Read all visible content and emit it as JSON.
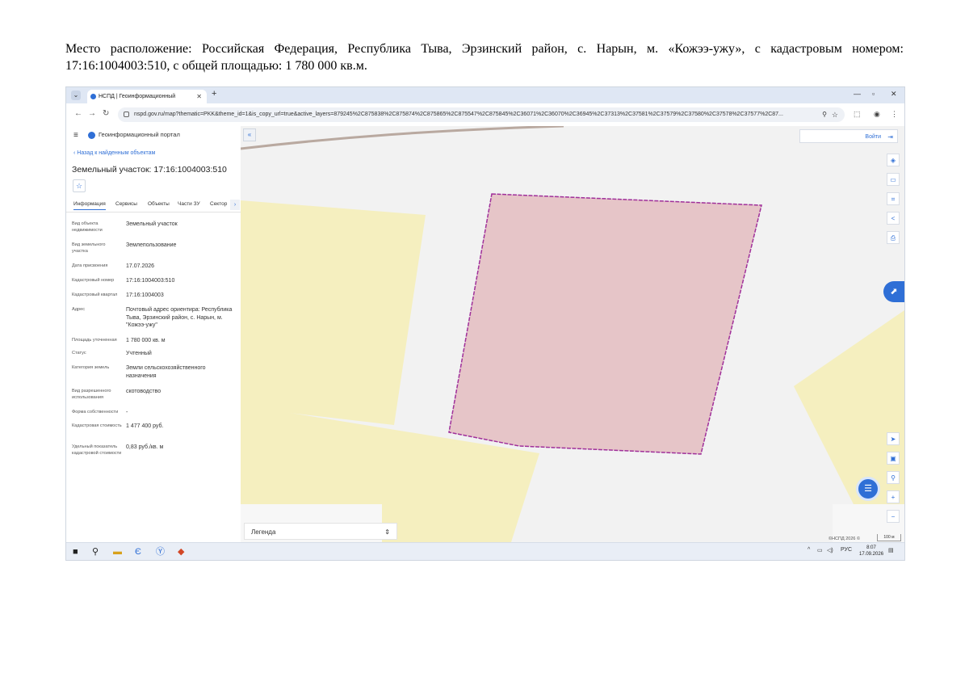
{
  "caption": "Место расположение: Российская Федерация, Республика Тыва, Эрзинский район, с. Нарын, м. «Кожээ-ужу», с кадастровым номером: 17:16:1004003:510, с общей площадью: 1 780 000 кв.м.",
  "browser": {
    "tab_title": "НСПД | Геоинформационный",
    "url": "nspd.gov.ru/map?thematic=PKK&theme_id=1&is_copy_url=true&active_layers=879245%2C875838%2C875874%2C875865%2C875547%2C875845%2C36071%2C36070%2C36945%2C37313%2C37581%2C37579%2C37580%2C37578%2C37577%2C87..."
  },
  "panel": {
    "portal_title": "Геоинформационный портал",
    "back_link": "Назад к найденным объектам",
    "object_title": "Земельный участок: 17:16:1004003:510",
    "tabs": [
      "Информация",
      "Сервисы",
      "Объекты",
      "Части ЗУ",
      "Сектор"
    ],
    "fields": [
      {
        "k": "Вид объекта недвижимости",
        "v": "Земельный участок"
      },
      {
        "k": "Вид земельного участка",
        "v": "Землепользование"
      },
      {
        "k": "Дата присвоения",
        "v": "17.07.2026"
      },
      {
        "k": "Кадастровый номер",
        "v": "17:16:1004003:510"
      },
      {
        "k": "Кадастровый квартал",
        "v": "17:16:1004003"
      },
      {
        "k": "Адрес",
        "v": "Почтовый адрес ориентира: Республика Тыва, Эрзинский район, с. Нарын, м. \"Кожээ-ужу\""
      },
      {
        "k": "Площадь уточненная",
        "v": "1 780 000 кв. м"
      },
      {
        "k": "Статус",
        "v": "Учтенный"
      },
      {
        "k": "Категория земель",
        "v": "Земли сельскохозяйственного назначения"
      },
      {
        "k": "Вид разрешенного использования",
        "v": "скотоводство"
      },
      {
        "k": "Форма собственности",
        "v": "-"
      },
      {
        "k": "Кадастровая стоимость",
        "v": "1 477 400 руб."
      },
      {
        "k": "Удельный показатель кадастровой стоимости",
        "v": "0,83 руб./кв. м"
      }
    ]
  },
  "map": {
    "login_label": "Войти",
    "legend_label": "Легенда",
    "copyright": "©НСПД 2026 ©",
    "scale_label": "100 м",
    "colors": {
      "parcel_fill": "#e6c5c8",
      "parcel_stroke": "#a0309a",
      "agri_fill": "#f5efbf",
      "road": "#b9a9a0",
      "background": "#f2f2f2"
    }
  },
  "taskbar": {
    "lang": "РУС",
    "time": "8:07",
    "date": "17.09.2026"
  },
  "icons": [
    "menu-icon",
    "search-icon",
    "explorer-icon",
    "edge-icon",
    "yandex-icon",
    "powerpoint-icon"
  ]
}
